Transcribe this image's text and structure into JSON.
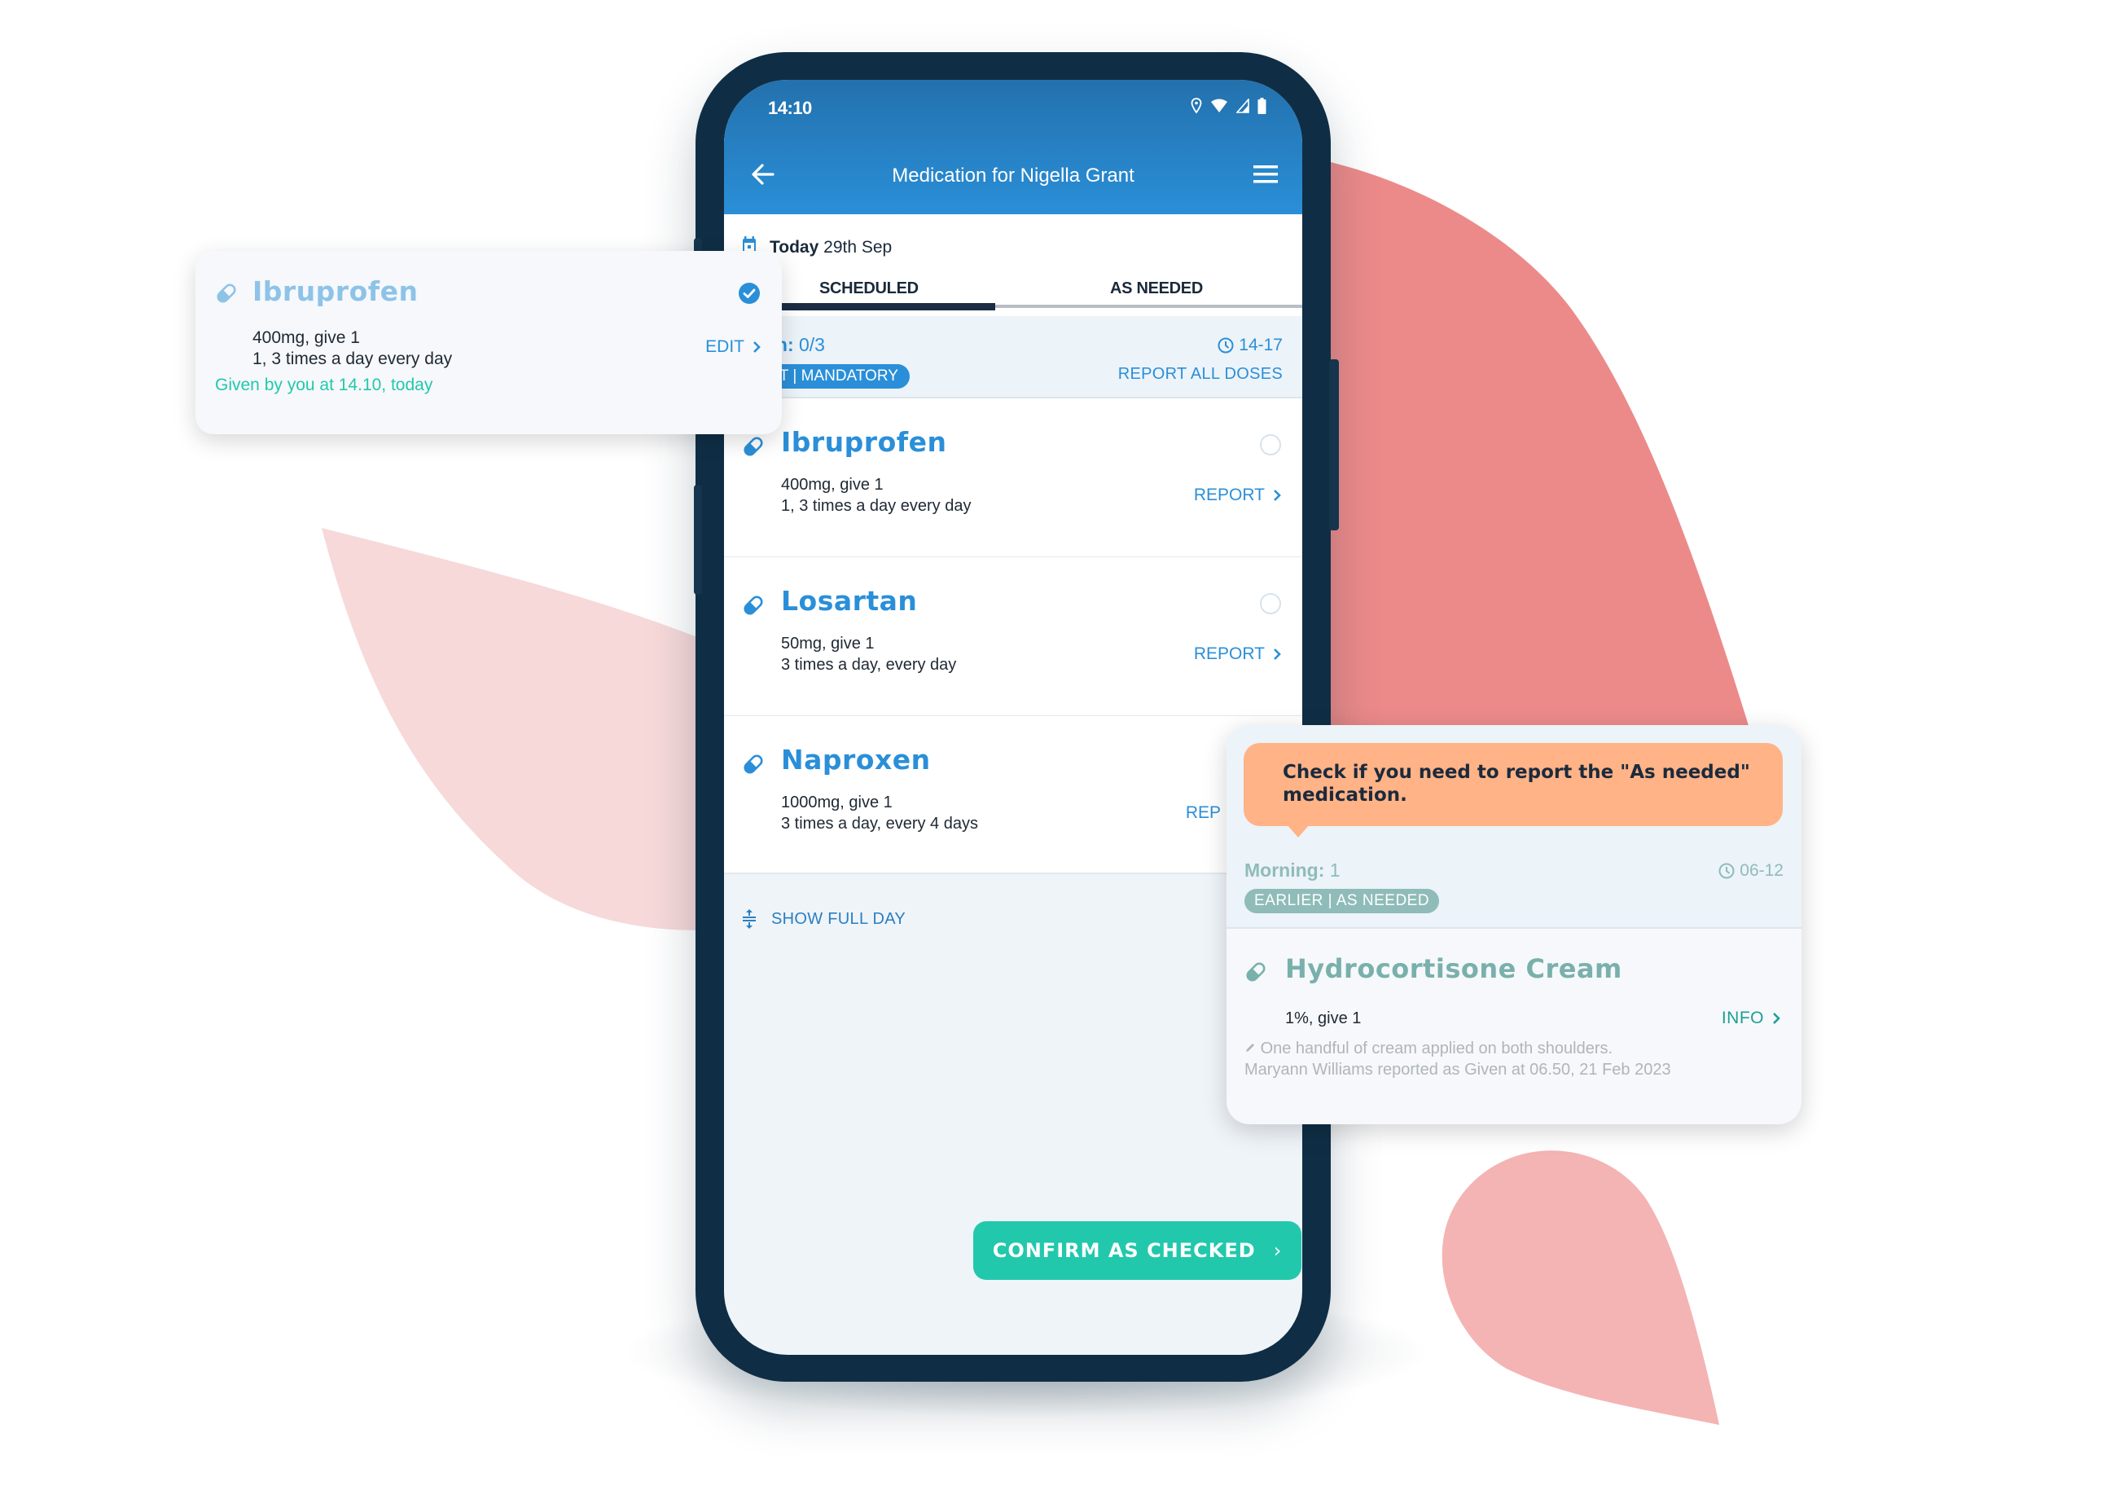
{
  "colors": {
    "brand_blue": "#2a8fd8",
    "header_blue_top": "#2371ad",
    "phone_frame": "#0f2e45",
    "confirm_green": "#22c8ac",
    "tooltip_orange": "#ffb386",
    "as_needed_teal": "#8fbcb8",
    "blob_light_pink": "#f7d9d9",
    "blob_coral": "#ec8a8a",
    "blob_pink": "#f4b4b4"
  },
  "status_bar": {
    "time": "14:10",
    "icons": [
      "location-icon",
      "wifi-icon",
      "signal-icon",
      "battery-icon"
    ]
  },
  "app_bar": {
    "title": "Medication for Nigella Grant",
    "back_icon": "arrow-left-icon",
    "menu_icon": "hamburger-menu-icon"
  },
  "date": {
    "label": "Today",
    "value": "29th Sep"
  },
  "tabs": [
    {
      "label": "SCHEDULED",
      "active": true
    },
    {
      "label": "AS NEEDED",
      "active": false
    }
  ],
  "section": {
    "period_label": "ernoon:",
    "count": "0/3",
    "badge": "RRENT | MANDATORY",
    "time_range": "14-17",
    "report_all": "REPORT ALL DOSES"
  },
  "medications": [
    {
      "name": "Ibruprofen",
      "dose": "400mg, give 1",
      "schedule": "1, 3 times a day every day",
      "action": "REPORT",
      "checked": false
    },
    {
      "name": "Losartan",
      "dose": "50mg, give 1",
      "schedule": "3 times a day, every day",
      "action": "REPORT",
      "checked": false
    },
    {
      "name": "Naproxen",
      "dose": "1000mg, give 1",
      "schedule": "3 times a day, every 4 days",
      "action": "REP",
      "checked": false
    }
  ],
  "show_full_day": "SHOW FULL DAY",
  "confirm_button": {
    "label": "CONFIRM AS CHECKED",
    "chevron": "›"
  },
  "given_card": {
    "name": "Ibruprofen",
    "dose": "400mg, give 1",
    "schedule": "1, 3 times a day every day",
    "given_text": "Given by you at 14.10, today",
    "action": "EDIT",
    "checked": true
  },
  "as_needed_card": {
    "tooltip": "Check if you need to report the \"As needed\" medication.",
    "period_label": "Morning:",
    "count": "1",
    "time_range": "06-12",
    "badge": "EARLIER | AS NEEDED",
    "name": "Hydrocortisone Cream",
    "dose": "1%, give 1",
    "action": "INFO",
    "note": "One handful of cream applied on both shoulders.",
    "reported": "Maryann Williams reported as Given at 06.50, 21 Feb 2023"
  }
}
